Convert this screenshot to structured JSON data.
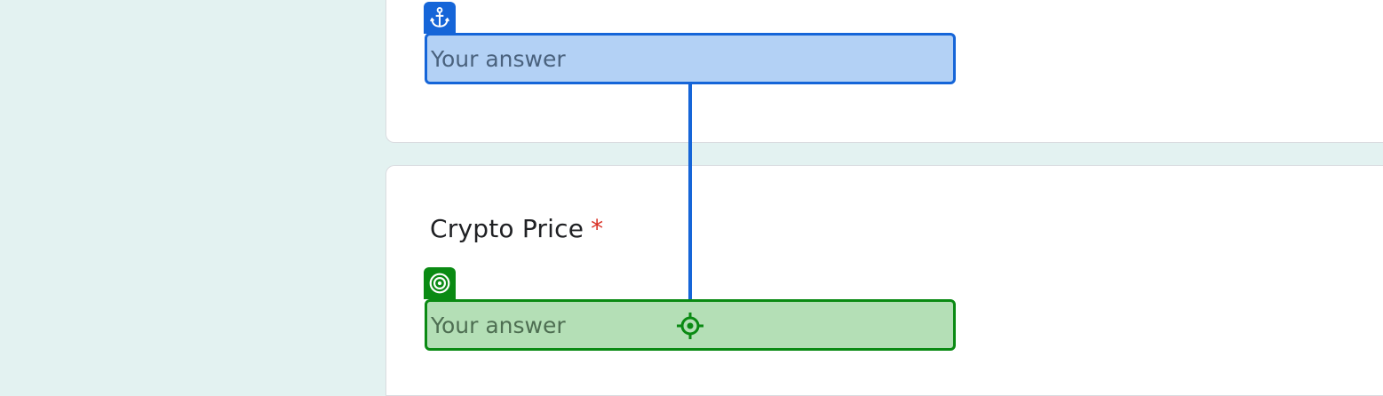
{
  "form": {
    "previous_question": {
      "answer_placeholder": "Your answer"
    },
    "question": {
      "title": "Crypto Price",
      "required_marker": "*",
      "answer_placeholder": "Your answer"
    }
  },
  "overlay": {
    "source_icon": "anchor-icon",
    "target_icon": "target-icon",
    "pointer_icon": "crosshair-icon",
    "colors": {
      "source": "#1565d8",
      "source_fill": "#b3d1f5",
      "target": "#0a8a13",
      "target_fill": "#b4dfb6"
    }
  },
  "colors": {
    "page_background": "#e3f2f1",
    "card_background": "#ffffff",
    "required": "#d93025"
  }
}
